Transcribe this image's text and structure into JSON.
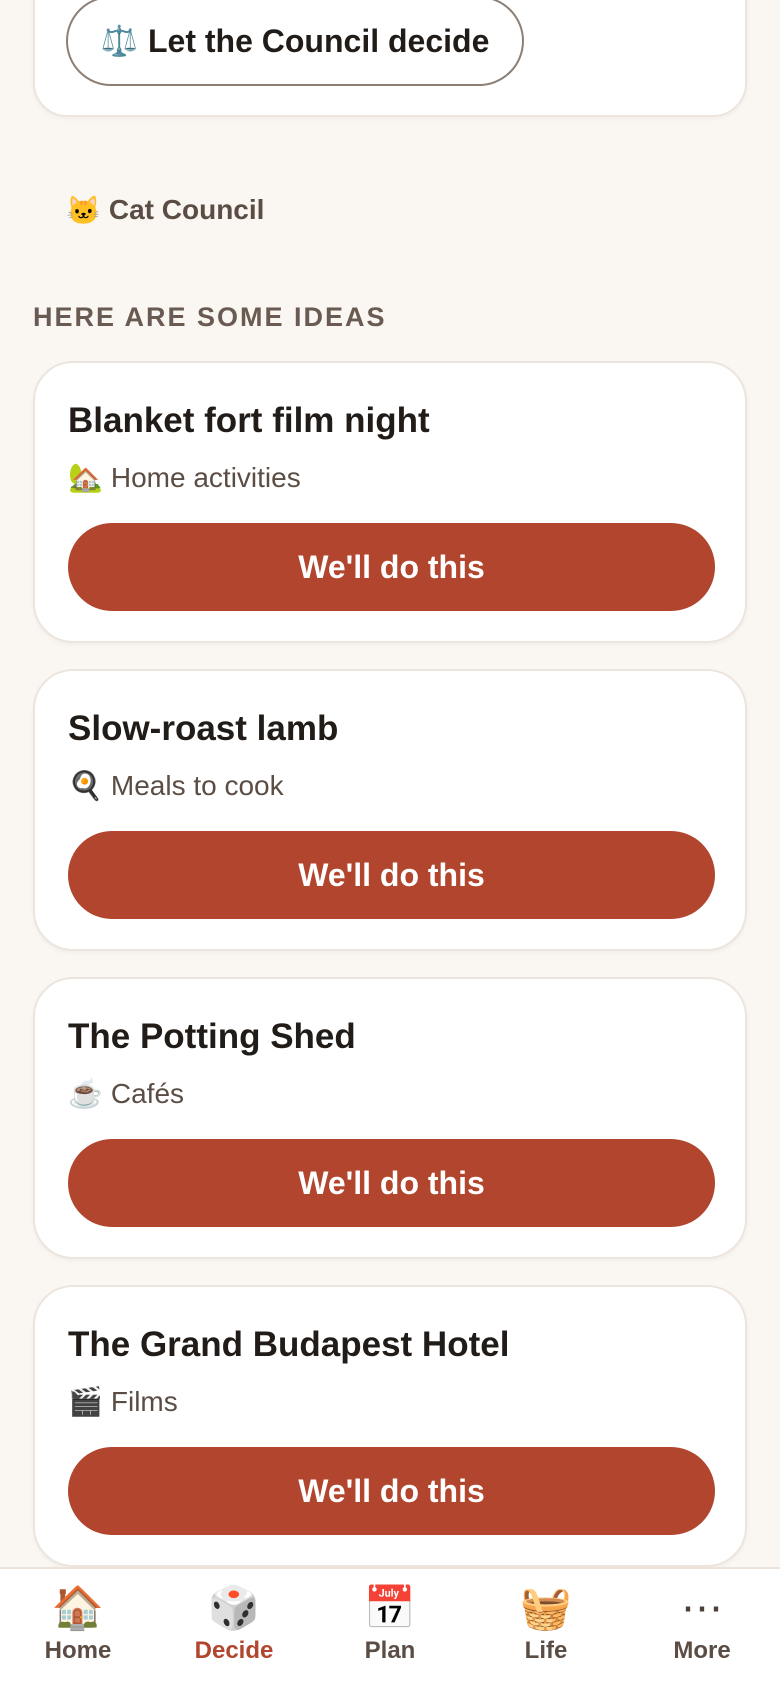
{
  "council_card": {
    "button_icon": "⚖️",
    "button_label": "Let the Council decide"
  },
  "cat_council": {
    "icon": "🐱",
    "label": "Cat Council"
  },
  "ideas_section": {
    "heading": "HERE ARE SOME IDEAS",
    "items": [
      {
        "title": "Blanket fort film night",
        "category_icon": "🏡",
        "category": "Home activities",
        "action_label": "We'll do this"
      },
      {
        "title": "Slow-roast lamb",
        "category_icon": "🍳",
        "category": "Meals to cook",
        "action_label": "We'll do this"
      },
      {
        "title": "The Potting Shed",
        "category_icon": "☕",
        "category": "Cafés",
        "action_label": "We'll do this"
      },
      {
        "title": "The Grand Budapest Hotel",
        "category_icon": "🎬",
        "category": "Films",
        "action_label": "We'll do this"
      }
    ]
  },
  "bottom_nav": {
    "accent_color": "#b1452d",
    "active": "Decide",
    "items": [
      {
        "icon": "🏠",
        "label": "Home"
      },
      {
        "icon": "🎲",
        "label": "Decide"
      },
      {
        "icon": "📅",
        "label": "Plan"
      },
      {
        "icon": "🧺",
        "label": "Life"
      },
      {
        "icon": "⋯",
        "label": "More"
      }
    ]
  }
}
